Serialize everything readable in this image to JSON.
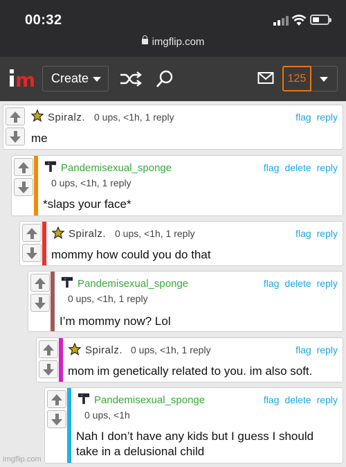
{
  "status_bar": {
    "time": "00:32",
    "url": "imgflip.com"
  },
  "nav": {
    "create_label": "Create",
    "notification_count": "125"
  },
  "actions": {
    "flag": "flag",
    "delete": "delete",
    "reply": "reply"
  },
  "comments": [
    {
      "user": "Spiralz.",
      "meta": "0 ups, <1h, 1 reply",
      "text": "me",
      "bar_color": ""
    },
    {
      "user": "Pandemisexual_sponge",
      "meta": "0 ups, <1h, 1 reply",
      "text": "*slaps your face*",
      "bar_color": "#f28b00"
    },
    {
      "user": "Spiralz.",
      "meta": "0 ups, <1h, 1 reply",
      "text": "mommy how could you do that",
      "bar_color": "#e8332b"
    },
    {
      "user": "Pandemisexual_sponge",
      "meta": "0 ups, <1h, 1 reply",
      "text": "I’m mommy now? Lol",
      "bar_color": "#9e5a5a"
    },
    {
      "user": "Spiralz.",
      "meta": "0 ups, <1h, 1 reply",
      "text": "mom im genetically related to you. im also soft.",
      "bar_color": "#d61fc4"
    },
    {
      "user": "Pandemisexual_sponge",
      "meta": "0 ups, <1h",
      "text_line1": "Nah I don’t have any kids but I guess I should",
      "text_line2": "take in a delusional child",
      "bar_color": "#1cb2e8"
    }
  ],
  "watermark": "imgflip.com"
}
